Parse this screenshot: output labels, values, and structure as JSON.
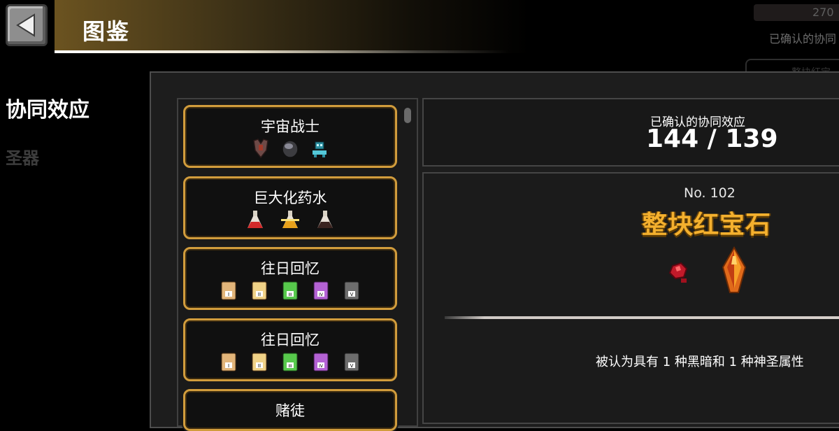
{
  "header": {
    "title": "图鉴",
    "back_icon": "back-arrow-icon"
  },
  "top_right": {
    "count_text": "270",
    "label": "已确认的协同",
    "box_text": "整块红宝"
  },
  "nav": {
    "items": [
      {
        "label": "协同效应",
        "active": true
      },
      {
        "label": "圣器",
        "active": false
      }
    ]
  },
  "synergy_list": [
    {
      "title": "宇宙战士",
      "icons": [
        "armor-icon",
        "helmet-icon",
        "robot-icon"
      ]
    },
    {
      "title": "巨大化药水",
      "icons": [
        "red-potion-icon",
        "yellow-potion-icon",
        "dark-potion-icon"
      ]
    },
    {
      "title": "往日回忆",
      "icons": [
        "card-i-icon",
        "card-ii-icon",
        "card-iii-icon",
        "card-iv-icon",
        "card-v-icon"
      ]
    },
    {
      "title": "往日回忆",
      "icons": [
        "card-i-icon",
        "card-ii-icon",
        "card-iii-icon",
        "card-iv-icon",
        "card-v-icon"
      ]
    },
    {
      "title": "赌徒",
      "icons": []
    }
  ],
  "stats": {
    "label": "已确认的协同效应",
    "value": "144 / 139"
  },
  "detail": {
    "number": "No. 102",
    "name": "整块红宝石",
    "icons": [
      "ruby-fragment-icon",
      "ruby-crystal-icon"
    ],
    "description": "被认为具有 1 种黑暗和 1 种神圣属性"
  },
  "colors": {
    "accent_gold": "#d19c3c",
    "name_gold": "#f4b02e",
    "panel_bg": "#1d1d1d"
  }
}
